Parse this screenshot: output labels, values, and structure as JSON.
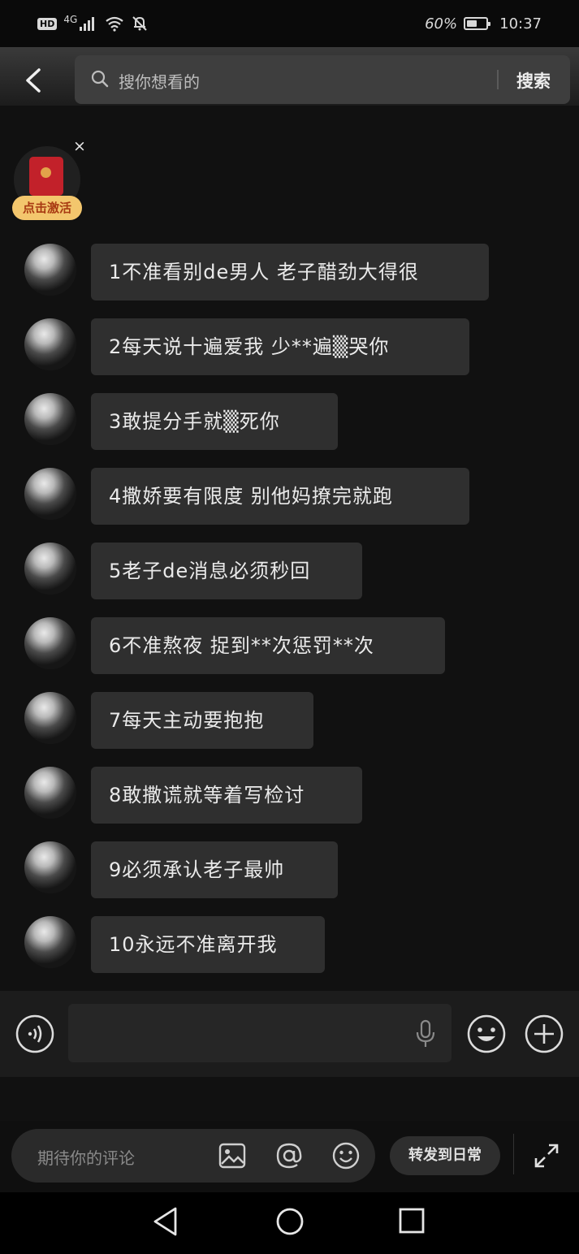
{
  "status_bar": {
    "network": "4G",
    "hd": "HD",
    "battery": "60%",
    "time": "10:37",
    "battery_level": 0.6
  },
  "header": {
    "search_placeholder": "搜你想看的",
    "search_button": "搜索"
  },
  "red_packet": {
    "label": "点击激活",
    "close": "×"
  },
  "messages": [
    {
      "text": "1不准看别de男人 老子醋劲大得很"
    },
    {
      "text": "2每天说十遍爱我 少**遍▒哭你"
    },
    {
      "text": "3敢提分手就▒死你"
    },
    {
      "text": "4撒娇要有限度 别他妈撩完就跑"
    },
    {
      "text": "5老子de消息必须秒回"
    },
    {
      "text": "6不准熬夜 捉到**次惩罚**次"
    },
    {
      "text": "7每天主动要抱抱"
    },
    {
      "text": "8敢撒谎就等着写检讨"
    },
    {
      "text": "9必须承认老子最帅"
    },
    {
      "text": "10永远不准离开我"
    }
  ],
  "input_bar": {
    "icons": [
      "voice-icon",
      "microphone-icon",
      "emoji-icon",
      "plus-icon"
    ]
  },
  "comment_bar": {
    "placeholder": "期待你的评论",
    "repost_label": "转发到日常",
    "icons": [
      "image-icon",
      "at-icon",
      "emoji-icon",
      "expand-icon"
    ]
  },
  "nav_bar": {
    "icons": [
      "back-triangle-icon",
      "home-circle-icon",
      "recents-square-icon"
    ]
  },
  "colors": {
    "background": "#111111",
    "bubble": "#2f2f2f",
    "red_packet": "#c2212a",
    "red_packet_label_bg": "#f3c66d"
  }
}
